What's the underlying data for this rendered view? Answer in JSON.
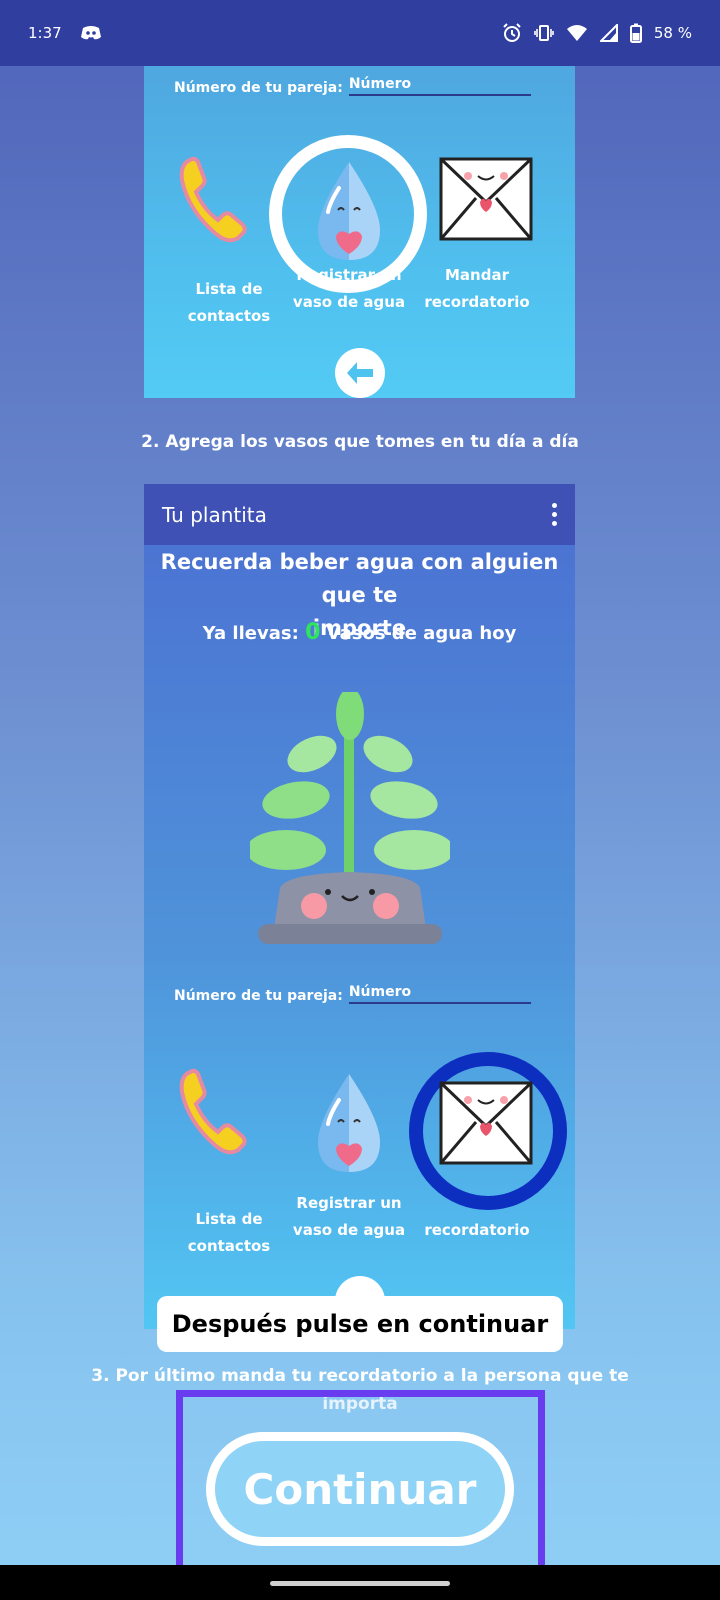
{
  "status_bar": {
    "time": "1:37",
    "battery": "58 %",
    "icons": [
      "discord-icon",
      "alarm-icon",
      "vibrate-icon",
      "wifi-icon",
      "signal-icon",
      "battery-icon"
    ]
  },
  "top_panel": {
    "partner_label": "Número de tu pareja:",
    "partner_placeholder": "Número",
    "contacts_label_1": "Lista de",
    "contacts_label_2": "contactos",
    "register_label_1": "Registrar un",
    "register_label_2": "vaso de agua",
    "send_label_1": "Mandar",
    "send_label_2": "recordatorio"
  },
  "step2": "2. Agrega los vasos que tomes en tu día a día",
  "bottom_panel": {
    "app_title": "Tu plantita",
    "remind_line_1": "Recuerda beber agua con alguien que te",
    "remind_line_2": "importe",
    "count_prefix": "Ya llevas:",
    "count_value": "0",
    "count_suffix": "Vasos de agua hoy",
    "partner_label": "Número de tu pareja:",
    "partner_placeholder": "Número",
    "contacts_label_1": "Lista de",
    "contacts_label_2": "contactos",
    "register_label_1": "Registrar un",
    "register_label_2": "vaso de agua",
    "send_label_2": "recordatorio"
  },
  "toast": "Después pulse en continuar",
  "step3_line_1": "3. Por último manda tu recordatorio a la persona que te",
  "step3_line_2": "importa",
  "continue_label": "Continuar",
  "colors": {
    "status_bar": "#303f9f",
    "app_bar": "#3f51b5",
    "highlight": "#6a3cf0",
    "blue_ring": "#0d2fc0",
    "counter": "#2ee65a"
  }
}
